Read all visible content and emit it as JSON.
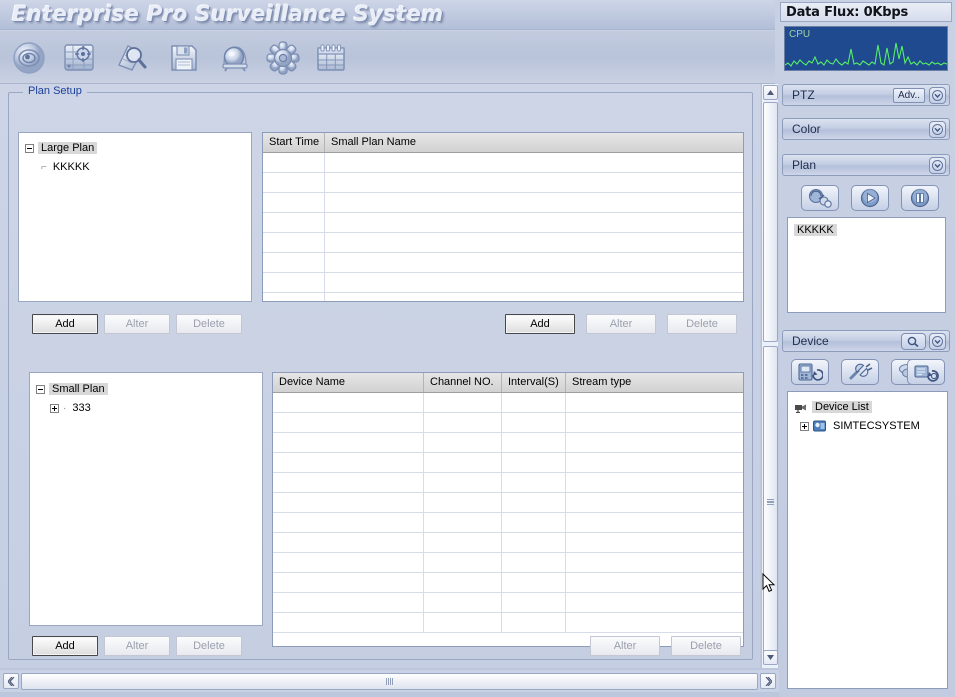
{
  "app": {
    "title": "Enterprise Pro Surveillance System"
  },
  "toolbar": {
    "buttons": [
      {
        "name": "preview-icon",
        "label": "Preview"
      },
      {
        "name": "playback-icon",
        "label": "Playback"
      },
      {
        "name": "search-icon",
        "label": "Search"
      },
      {
        "name": "save-icon",
        "label": "Save"
      },
      {
        "name": "alarm-icon",
        "label": "Alarm"
      },
      {
        "name": "settings-icon",
        "label": "Settings"
      },
      {
        "name": "schedule-icon",
        "label": "Schedule"
      }
    ]
  },
  "main": {
    "group_label": "Plan Setup",
    "large_plan": {
      "root": "Large Plan",
      "children": [
        "KKKKK"
      ]
    },
    "small_plan_table": {
      "columns": [
        "Start Time",
        "Small Plan Name"
      ],
      "rows": [],
      "empty_row_count": 8
    },
    "large_plan_buttons": {
      "add": "Add",
      "alter": "Alter",
      "delete": "Delete"
    },
    "small_plan_table_buttons": {
      "add": "Add",
      "alter": "Alter",
      "delete": "Delete"
    },
    "small_plan": {
      "root": "Small Plan",
      "children": [
        "333"
      ]
    },
    "device_table": {
      "columns": [
        "Device Name",
        "Channel NO.",
        "Interval(S)",
        "Stream type"
      ],
      "rows": [],
      "empty_row_count": 12
    },
    "small_plan_buttons": {
      "add": "Add",
      "alter": "Alter",
      "delete": "Delete"
    },
    "device_table_buttons": {
      "alter": "Alter",
      "delete": "Delete"
    }
  },
  "sidebar": {
    "data_flux": "Data Flux: 0Kbps",
    "cpu_label": "CPU",
    "cpu_color": "#55ee66",
    "cpu_bg": "#1f4a8f",
    "ptz": {
      "title": "PTZ",
      "adv_label": "Adv..",
      "chevron": "chevron-down-icon"
    },
    "color": {
      "title": "Color",
      "chevron": "chevron-down-icon"
    },
    "plan": {
      "title": "Plan",
      "chevron": "chevron-down-icon",
      "buttons": [
        {
          "name": "plan-config-icon",
          "label": "Configure Plan"
        },
        {
          "name": "plan-play-icon",
          "label": "Start Plan"
        },
        {
          "name": "plan-pause-icon",
          "label": "Pause Plan"
        }
      ],
      "list_items": [
        "KKKKK"
      ]
    },
    "device": {
      "title": "Device",
      "search_icon": "search-icon",
      "chevron": "chevron-down-icon",
      "buttons": [
        {
          "name": "device-add-icon",
          "label": "Add Device"
        },
        {
          "name": "device-connect-icon",
          "label": "Connect"
        },
        {
          "name": "device-group-icon",
          "label": "Device Group"
        },
        {
          "name": "device-sync-icon",
          "label": "Sync Device"
        }
      ],
      "tree": {
        "root": "Device List",
        "children": [
          "SIMTECSYSTEM"
        ]
      }
    }
  },
  "scrollbars": {
    "vertical": {
      "up": "scroll-up-icon",
      "down": "scroll-down-icon"
    },
    "horizontal": {
      "left": "scroll-left-icon",
      "right": "scroll-right-icon"
    }
  }
}
